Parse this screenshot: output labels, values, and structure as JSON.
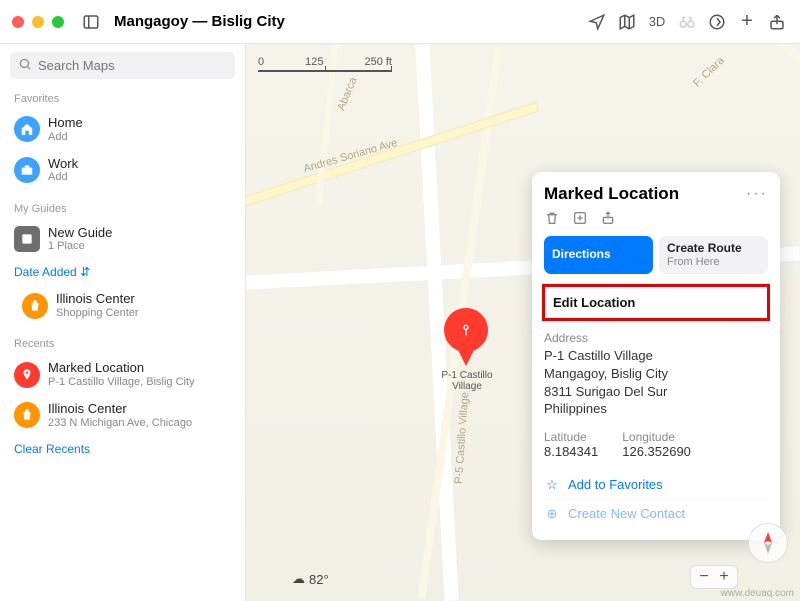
{
  "titlebar": {
    "title": "Mangagoy — Bislig City",
    "view3d": "3D"
  },
  "sidebar": {
    "search_placeholder": "Search Maps",
    "sections": {
      "favorites": "Favorites",
      "my_guides": "My Guides",
      "recents": "Recents"
    },
    "favorites": [
      {
        "title": "Home",
        "sub": "Add"
      },
      {
        "title": "Work",
        "sub": "Add"
      }
    ],
    "guides": [
      {
        "title": "New Guide",
        "sub": "1 Place"
      }
    ],
    "guide_sort": "Date Added",
    "guide_places": [
      {
        "title": "Illinois Center",
        "sub": "Shopping Center"
      }
    ],
    "recents": [
      {
        "title": "Marked Location",
        "sub": "P-1 Castillo Village, Bislig City"
      },
      {
        "title": "Illinois Center",
        "sub": "233 N Michigan Ave, Chicago"
      }
    ],
    "clear_recents": "Clear Recents"
  },
  "map": {
    "scale": {
      "a": "0",
      "b": "125",
      "c": "250 ft"
    },
    "pin_label": "P-1 Castillo Village",
    "road_labels": {
      "soriano": "Andres Soriano Ave",
      "castillo": "P-5 Castillo Village",
      "castillo2": "P-1 Castillo Village",
      "abarca": "Abarca",
      "fclara": "F. Clara"
    },
    "weather": "82°",
    "compass": "N",
    "zoom_minus": "−",
    "zoom_plus": "+"
  },
  "card": {
    "title": "Marked Location",
    "more": "···",
    "directions": "Directions",
    "create_route": "Create Route",
    "create_route_sub": "From Here",
    "edit_location": "Edit Location",
    "address_label": "Address",
    "address": {
      "l1": "P-1 Castillo Village",
      "l2": "Mangagoy, Bislig City",
      "l3": "8311 Surigao Del Sur",
      "l4": "Philippines"
    },
    "lat_label": "Latitude",
    "lat_value": "8.184341",
    "lon_label": "Longitude",
    "lon_value": "126.352690",
    "add_favorites": "Add to Favorites",
    "create_contact": "Create New Contact"
  },
  "watermark": "www.deuaq.com"
}
